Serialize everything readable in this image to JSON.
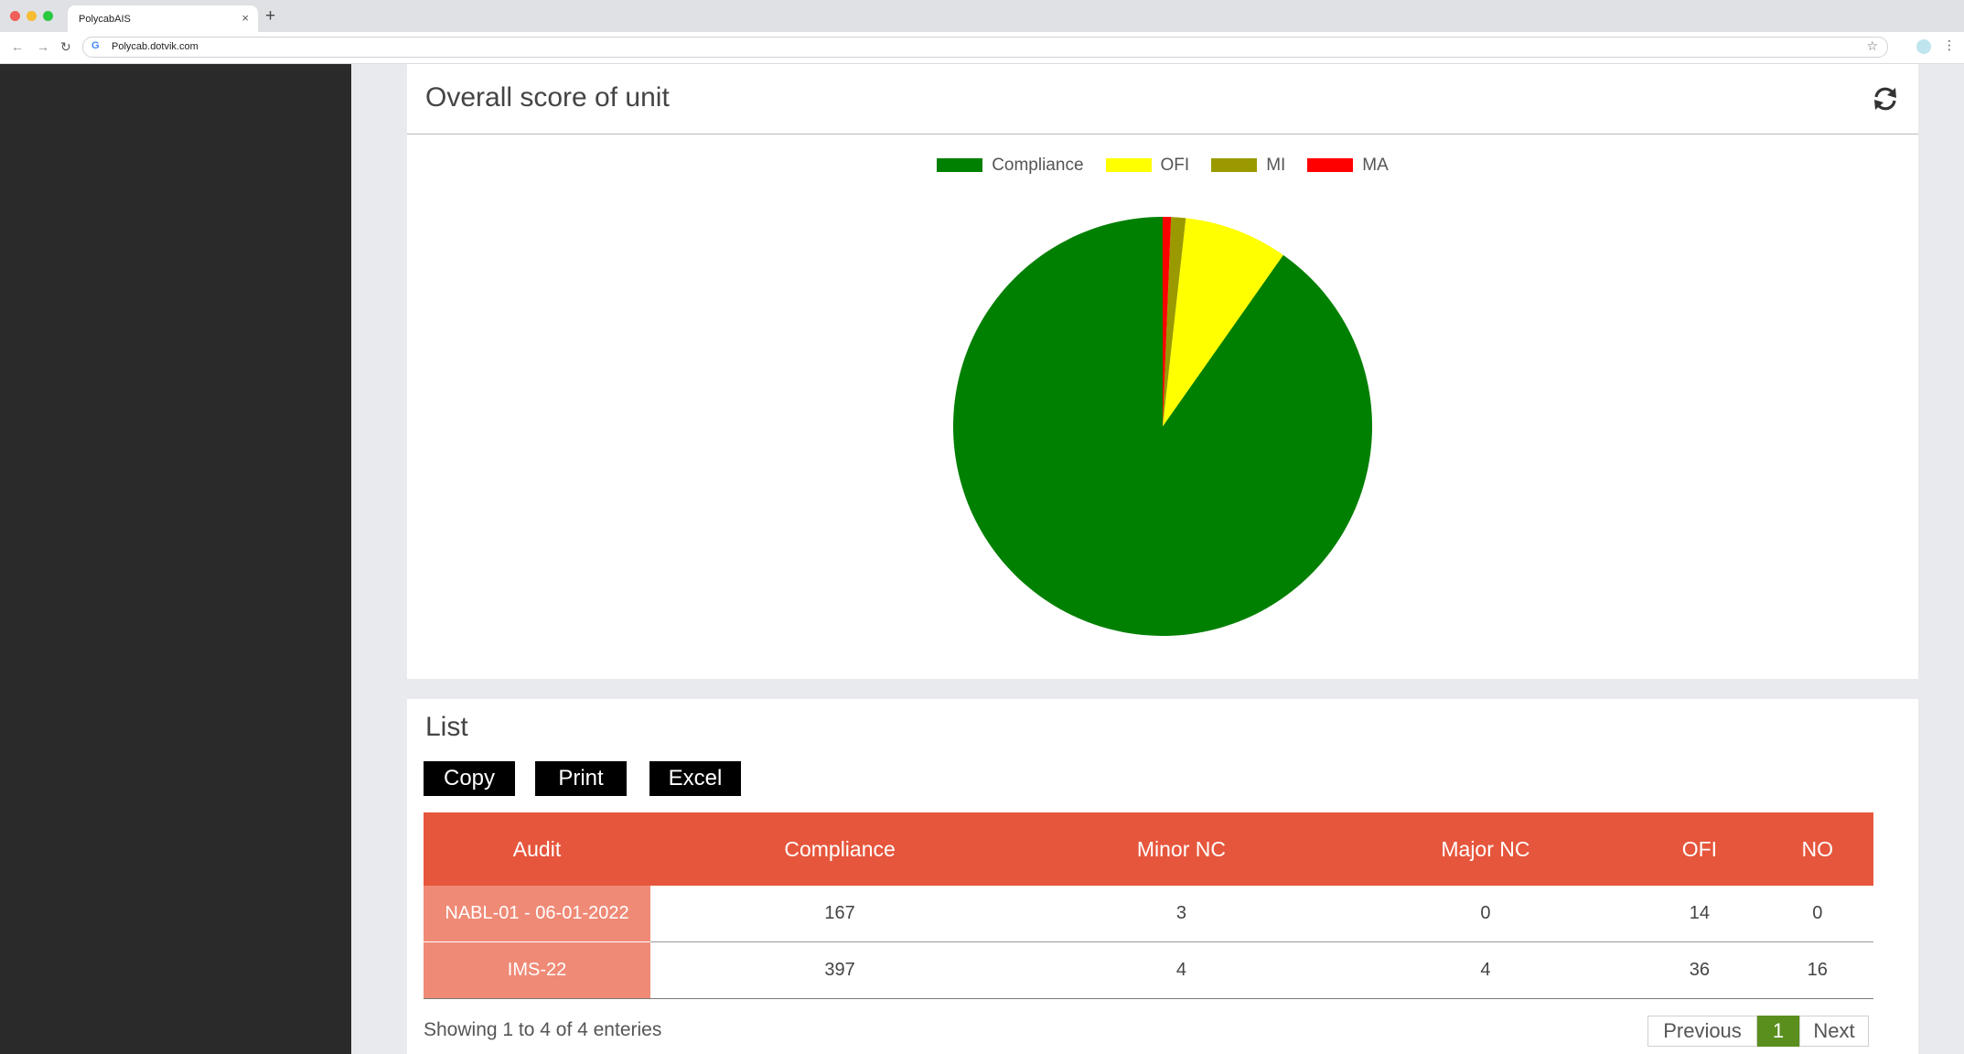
{
  "browser": {
    "tab_title": "PolycabAIS",
    "tab_close": "×",
    "new_tab": "+",
    "url": "Polycab.dotvik.com",
    "back": "←",
    "forward": "→",
    "reload": "↻",
    "star": "☆",
    "menu": "⋮"
  },
  "score_card": {
    "title": "Overall score of unit",
    "refresh_icon": "refresh-icon"
  },
  "chart_data": {
    "type": "pie",
    "title": "",
    "categories": [
      "Compliance",
      "OFI",
      "MI",
      "MA"
    ],
    "values": [
      564,
      50,
      7,
      4
    ],
    "colors": [
      "#008000",
      "#ffff00",
      "#9a9a00",
      "#ff0000"
    ],
    "legend": "top"
  },
  "list_card": {
    "title": "List",
    "buttons": {
      "copy": "Copy",
      "print": "Print",
      "excel": "Excel"
    },
    "columns": [
      "Audit",
      "Compliance",
      "Minor NC",
      "Major NC",
      "OFI",
      "NO"
    ],
    "rows": [
      [
        "NABL-01 - 06-01-2022",
        "167",
        "3",
        "0",
        "14",
        "0"
      ],
      [
        "IMS-22",
        "397",
        "4",
        "4",
        "36",
        "16"
      ]
    ],
    "info": "Showing 1 to 4 of 4 enteries",
    "pager": {
      "previous": "Previous",
      "current": "1",
      "next": "Next"
    }
  }
}
